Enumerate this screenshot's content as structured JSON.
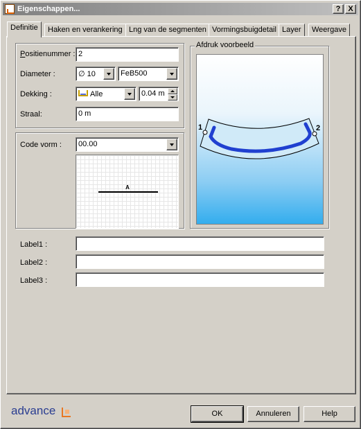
{
  "window": {
    "title": "Eigenschappen..."
  },
  "titlebar_buttons": {
    "help": "?",
    "close": "X"
  },
  "tabs": [
    {
      "label": "Definitie",
      "active": true
    },
    {
      "label": "Haken en verankering"
    },
    {
      "label": "Lng van de segmenten"
    },
    {
      "label": "Vormingsbuigdetail"
    },
    {
      "label": "Layer"
    },
    {
      "label": "Weergave"
    }
  ],
  "definition": {
    "positienummer": {
      "label": "Positienummer :",
      "value": "2"
    },
    "diameter": {
      "label": "Diameter :",
      "value": "∅ 10",
      "grade": "FeB500"
    },
    "dekking": {
      "label": "Dekking :",
      "value": "Alle",
      "amount": "0.04 m"
    },
    "straal": {
      "label": "Straal:",
      "value": "0 m"
    }
  },
  "shape": {
    "code_label": "Code vorm :",
    "code_value": "00.00",
    "segment_label": "A"
  },
  "preview": {
    "caption": "Afdruk voorbeeld",
    "marker_start": "1",
    "marker_end": "2"
  },
  "labels": [
    {
      "label": "Label1 :",
      "value": ""
    },
    {
      "label": "Label2 :",
      "value": ""
    },
    {
      "label": "Label3 :",
      "value": ""
    }
  ],
  "footer": {
    "brand": "advance",
    "ok": "OK",
    "cancel": "Annuleren",
    "help": "Help"
  },
  "colors": {
    "brand": "#2a3d91",
    "accent": "#e87722",
    "bar_blue": "#2040d0"
  }
}
